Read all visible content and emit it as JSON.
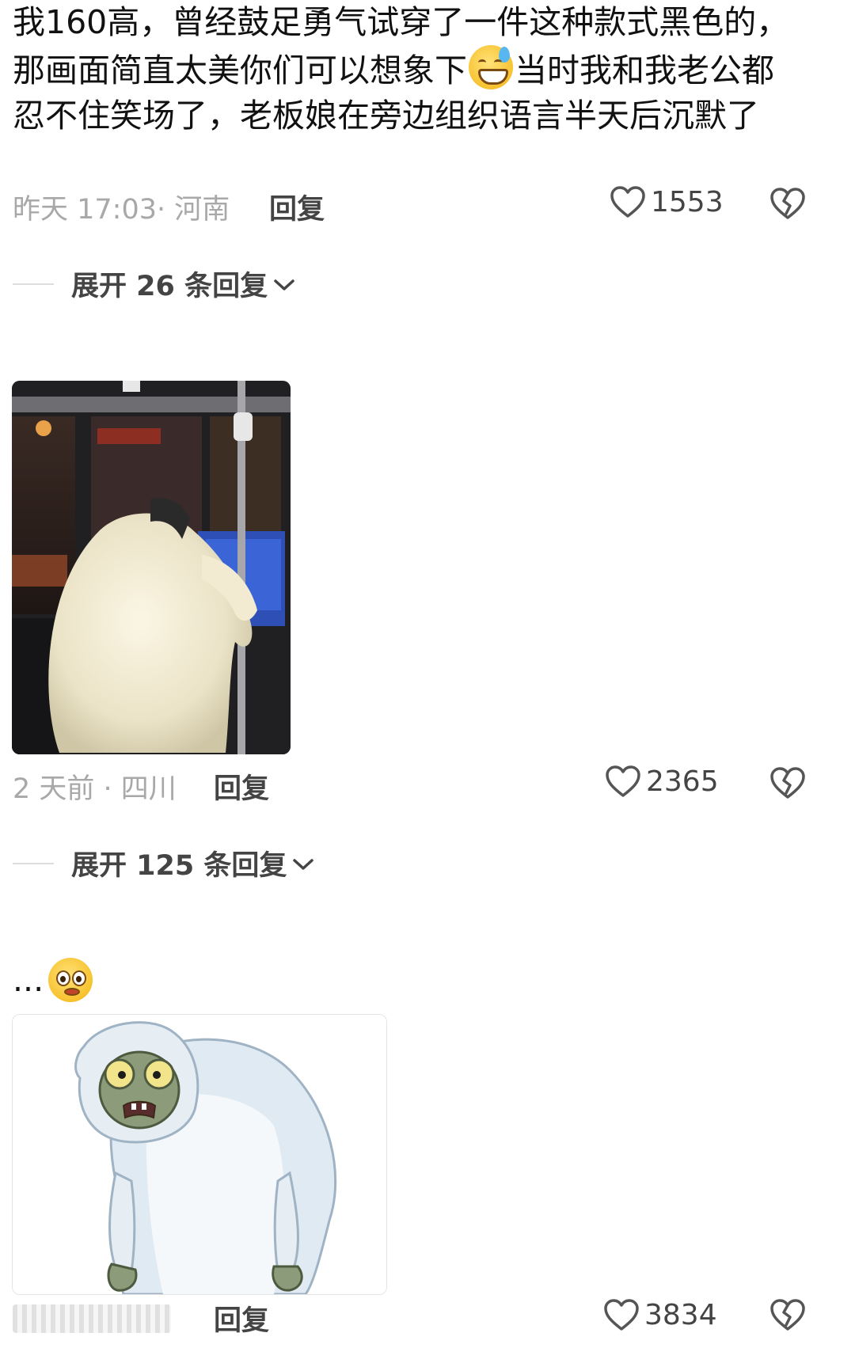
{
  "comments": [
    {
      "text_before_emoji": "我160高，曾经鼓足勇气试穿了一件这种款式黑色的，那画面简直太美你们可以想象下",
      "emoji": "grin-sweat-emoji",
      "text_after_emoji": "当时我和我老公都忍不住笑场了，老板娘在旁边组织语言半天后沉默了",
      "meta": "昨天 17:03· 河南",
      "reply_label": "回复",
      "likes": "1553",
      "expand_label": "展开 26 条回复"
    },
    {
      "image": "white-fluffy-coat-bus-photo",
      "meta": "2 天前 · 四川",
      "reply_label": "回复",
      "likes": "2365",
      "expand_label": "展开 125 条回复"
    },
    {
      "text": "...",
      "emoji": "pleading-emoji",
      "image": "yeti-zombie-cartoon",
      "reply_label": "回复",
      "likes": "3834"
    }
  ],
  "icons": {
    "like": "heart-outline-icon",
    "dislike": "broken-heart-icon",
    "expand": "chevron-down-icon"
  },
  "colors": {
    "meta_text": "#a8a8a8",
    "action_text": "#444444"
  }
}
